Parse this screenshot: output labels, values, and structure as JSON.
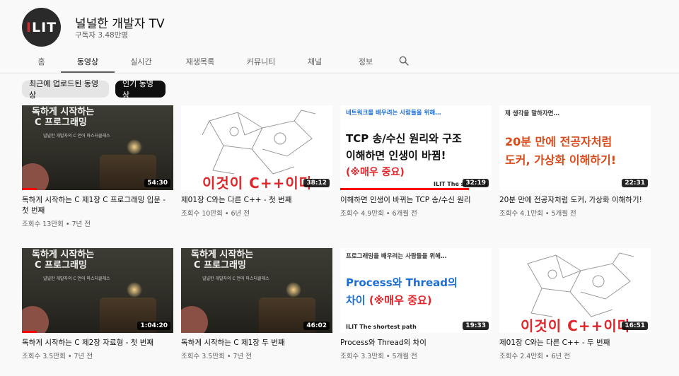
{
  "channel": {
    "avatar_text": "ILIT",
    "name": "널널한 개발자 TV",
    "subscribers": "구독자 3.48만명"
  },
  "tabs": [
    {
      "label": "홈"
    },
    {
      "label": "동영상",
      "active": true
    },
    {
      "label": "실시간"
    },
    {
      "label": "재생목록"
    },
    {
      "label": "커뮤니티"
    },
    {
      "label": "채널"
    },
    {
      "label": "정보"
    }
  ],
  "search_icon": "search-icon",
  "chips": {
    "recent": "최근에 업로드된 동영상",
    "popular": "인기 동영상"
  },
  "videos": [
    {
      "title": "독하게 시작하는 C 제1장 C 프로그래밍 입문 - 첫 번째",
      "meta": "조회수 13만회 • 7년 전",
      "duration": "54:30",
      "progress": 0.1,
      "thumb": {
        "style": "room",
        "line1": "독하게 시작하는",
        "line2": "C 프로그래밍",
        "small": "널널한 개발자의 C 언어 마스터클래스"
      }
    },
    {
      "title": "제01장 C와는 다른 C++ - 첫 번째",
      "meta": "조회수 10만회 • 6년 전",
      "duration": "38:12",
      "progress": 0,
      "thumb": {
        "style": "mech",
        "caption": "이것이 C++이다"
      }
    },
    {
      "title": "이해하면 인생이 바뀌는 TCP 송/수신 원리",
      "meta": "조회수 4.9만회 • 6개월 전",
      "duration": "32:19",
      "progress": 0.85,
      "thumb": {
        "style": "tcp",
        "small": "네트워크를 배우려는 사람들을 위해…",
        "line1": "TCP 송/수신 원리와 구조",
        "line2": "이해하면 인생이 바뀜!",
        "line3": "(※매우 중요)",
        "brand": "ILIT The shortest path"
      }
    },
    {
      "title": "20분 만에 전공자처럼 도커, 가상화 이해하기!",
      "meta": "조회수 4.1만회 • 5개월 전",
      "duration": "22:31",
      "progress": 0,
      "thumb": {
        "style": "docker",
        "small": "제 생각을 말하자면…",
        "line1": "20분 만에 전공자처럼",
        "line2": "도커, 가상화 이해하기!"
      }
    },
    {
      "title": "독하게 시작하는 C 제2장 자료형 - 첫 번째",
      "meta": "조회수 3.5만회 • 7년 전",
      "duration": "1:04:20",
      "progress": 0.1,
      "thumb": {
        "style": "room",
        "line1": "독하게 시작하는",
        "line2": "C 프로그래밍",
        "small": "널널한 개발자의 C 언어 마스터클래스"
      }
    },
    {
      "title": "독하게 시작하는 C 제1장 두 번째",
      "meta": "조회수 3.5만회 • 7년 전",
      "duration": "46:02",
      "progress": 0,
      "thumb": {
        "style": "room",
        "line1": "독하게 시작하는",
        "line2": "C 프로그래밍",
        "small": "널널한 개발자의 C 언어 마스터클래스"
      }
    },
    {
      "title": "Process와 Thread의 차이",
      "meta": "조회수 3.3만회 • 5개월 전",
      "duration": "19:33",
      "progress": 0,
      "thumb": {
        "style": "proc",
        "small": "프로그래밍을 배우려는 사람들을 위해…",
        "line1": "Process와 Thread의",
        "line2a": "차이 ",
        "line2b": "(※매우 중요)",
        "brand": "ILIT The shortest path"
      }
    },
    {
      "title": "제01장 C와는 다른 C++ - 두 번째",
      "meta": "조회수 2.4만회 • 6년 전",
      "duration": "16:51",
      "progress": 0,
      "thumb": {
        "style": "mech",
        "caption": "이것이 C++이다"
      }
    }
  ],
  "colors": {
    "progress": "#ff0000",
    "accent_red": "#e0262b",
    "accent_blue": "#1c6ed4"
  }
}
